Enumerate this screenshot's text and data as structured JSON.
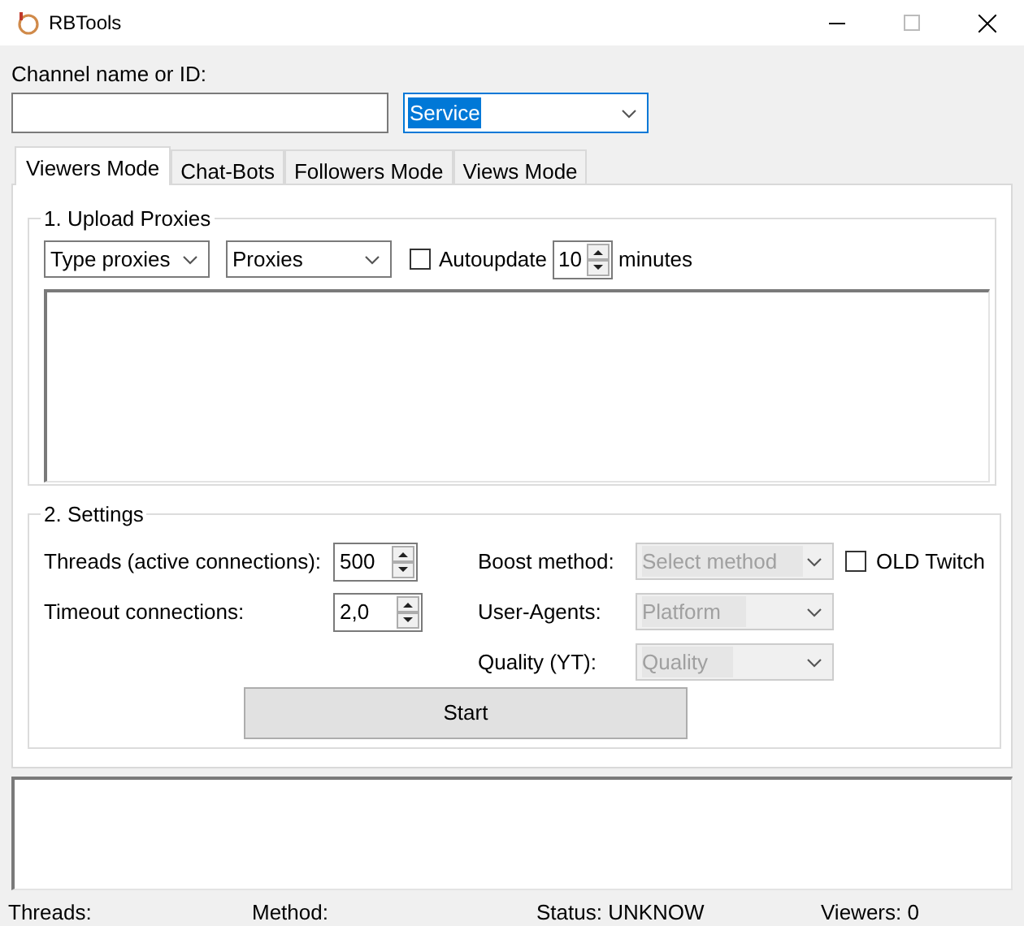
{
  "window": {
    "title": "RBTools"
  },
  "channel": {
    "label": "Channel name or ID:"
  },
  "service": {
    "value": "Service",
    "selected": true
  },
  "tabs": [
    {
      "label": "Viewers Mode",
      "selected": true
    },
    {
      "label": "Chat-Bots",
      "selected": false
    },
    {
      "label": "Followers Mode",
      "selected": false
    },
    {
      "label": "Views Mode",
      "selected": false
    }
  ],
  "upload_proxies": {
    "title": "1. Upload Proxies",
    "type_dropdown": "Type proxies",
    "source_dropdown": "Proxies",
    "autoupdate": {
      "label": "Autoupdate",
      "checked": false
    },
    "interval": "10",
    "unit": "minutes"
  },
  "settings": {
    "title": "2. Settings",
    "left": [
      {
        "label": "Threads (active connections):",
        "value": "500"
      },
      {
        "label": "Timeout connections:",
        "value": "2,0"
      }
    ],
    "right": [
      {
        "label": "Boost method:",
        "value": "Select method",
        "disabled": true
      },
      {
        "label": "User-Agents:",
        "value": "Platform",
        "disabled": true
      },
      {
        "label": "Quality (YT):",
        "value": "Quality",
        "disabled": true
      }
    ],
    "old_twitch": {
      "label": "OLD Twitch",
      "checked": false
    },
    "start": "Start"
  },
  "status_bar": [
    "Threads:",
    "Method:",
    "Status: UNKNOW",
    "Viewers: 0"
  ]
}
